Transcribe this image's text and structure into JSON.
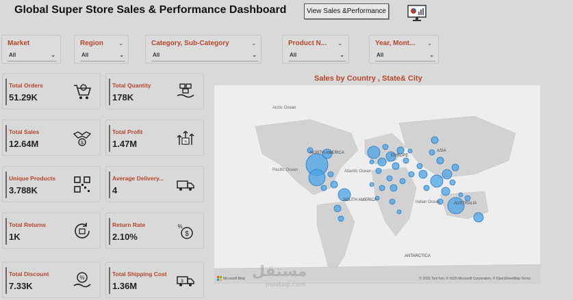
{
  "header": {
    "title": "Global Super Store Sales & Performance Dashboard",
    "view_button": "View Sales &Performance"
  },
  "filters": [
    {
      "label": "Market",
      "value": "All"
    },
    {
      "label": "Region",
      "value": "All"
    },
    {
      "label": "Category, Sub-Category",
      "value": "All"
    },
    {
      "label": "Product N...",
      "value": "All"
    },
    {
      "label": "Year, Mont...",
      "value": "All"
    }
  ],
  "kpis": [
    {
      "label": "Total Orders",
      "value": "51.29K",
      "icon": "cart-icon"
    },
    {
      "label": "Total Quantity",
      "value": "178K",
      "icon": "boxes-hand-icon"
    },
    {
      "label": "Total Sales",
      "value": "12.64M",
      "icon": "handshake-coin-icon"
    },
    {
      "label": "Total Profit",
      "value": "1.47M",
      "icon": "profit-growth-icon"
    },
    {
      "label": "Unique Products",
      "value": "3.788K",
      "icon": "qr-code-icon"
    },
    {
      "label": "Average Delivery...",
      "value": "4",
      "icon": "delivery-truck-icon"
    },
    {
      "label": "Total Returns",
      "value": "1K",
      "icon": "return-box-icon"
    },
    {
      "label": "Return Rate",
      "value": "2.10%",
      "icon": "coin-percent-icon"
    },
    {
      "label": "Total Discount",
      "value": "7.33K",
      "icon": "discount-hand-icon"
    },
    {
      "label": "Total Shipping Cost",
      "value": "1.36M",
      "icon": "shipping-truck-icon"
    }
  ],
  "map": {
    "title": "Sales by Country , State& City",
    "labels": {
      "arctic": "Arctic Ocean",
      "north_america": "NORTH AMERICA",
      "pacific": "Pacific Ocean",
      "atlantic": "Atlantic Ocean",
      "europe": "EUROPE",
      "asia": "ASIA",
      "south_america": "SOUTH AMERICA",
      "indian": "Indian Ocean",
      "australia": "AUSTRALIA",
      "antarctica": "ANTARCTICA"
    },
    "credit": "© 2025 TomTom, © 2025 Microsoft Corporation, © OpenStreetMap  Terms",
    "logo_text": "Microsoft Bing"
  },
  "watermark": {
    "arabic": "مستقل",
    "latin": "mostaql.com"
  }
}
